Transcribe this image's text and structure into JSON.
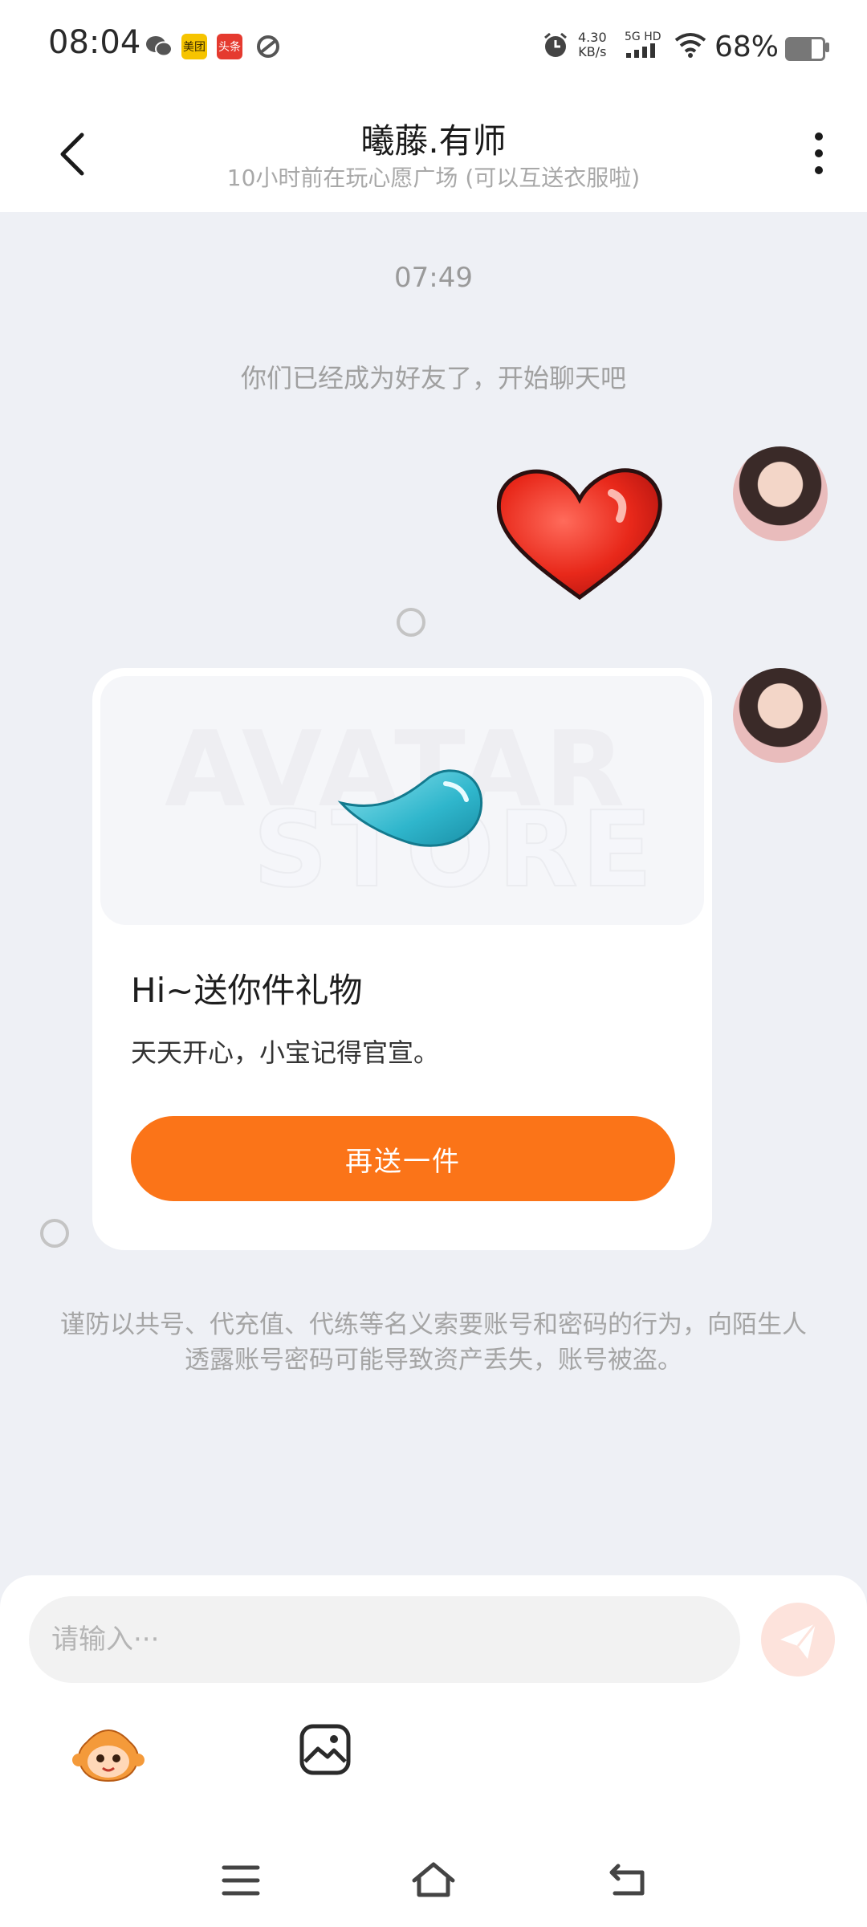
{
  "status_bar": {
    "time": "08:04",
    "net_speed_value": "4.30",
    "net_speed_unit": "KB/s",
    "signal_label": "5G HD",
    "battery": "68%",
    "battery_level": 0.68,
    "app_icons": [
      "wechat-icon",
      "meituan-icon",
      "toutiao-icon",
      "feed-icon",
      "alarm-icon",
      "signal-icon",
      "wifi-icon"
    ],
    "meituan_label": "美团",
    "toutiao_label": "头条"
  },
  "header": {
    "title": "曦藤.有师",
    "subtitle": "10小时前在玩心愿广场 (可以互送衣服啦)"
  },
  "chat": {
    "time_separator": "07:49",
    "system_message": "你们已经成为好友了，开始聊天吧",
    "gift_card": {
      "banner_text_1": "AVATAR",
      "banner_text_2": "STORE",
      "title": "Hi~送你件礼物",
      "message": "天天开心，小宝记得官宣。",
      "button_label": "再送一件"
    },
    "warning": "谨防以共号、代充值、代练等名义索要账号和密码的行为，向陌生人透露账号密码可能导致资产丢失，账号被盗。"
  },
  "input": {
    "placeholder": "请输入···"
  },
  "colors": {
    "accent_orange": "#fb7418",
    "background": "#eef0f5",
    "send_button_bg": "#fde3dc"
  }
}
